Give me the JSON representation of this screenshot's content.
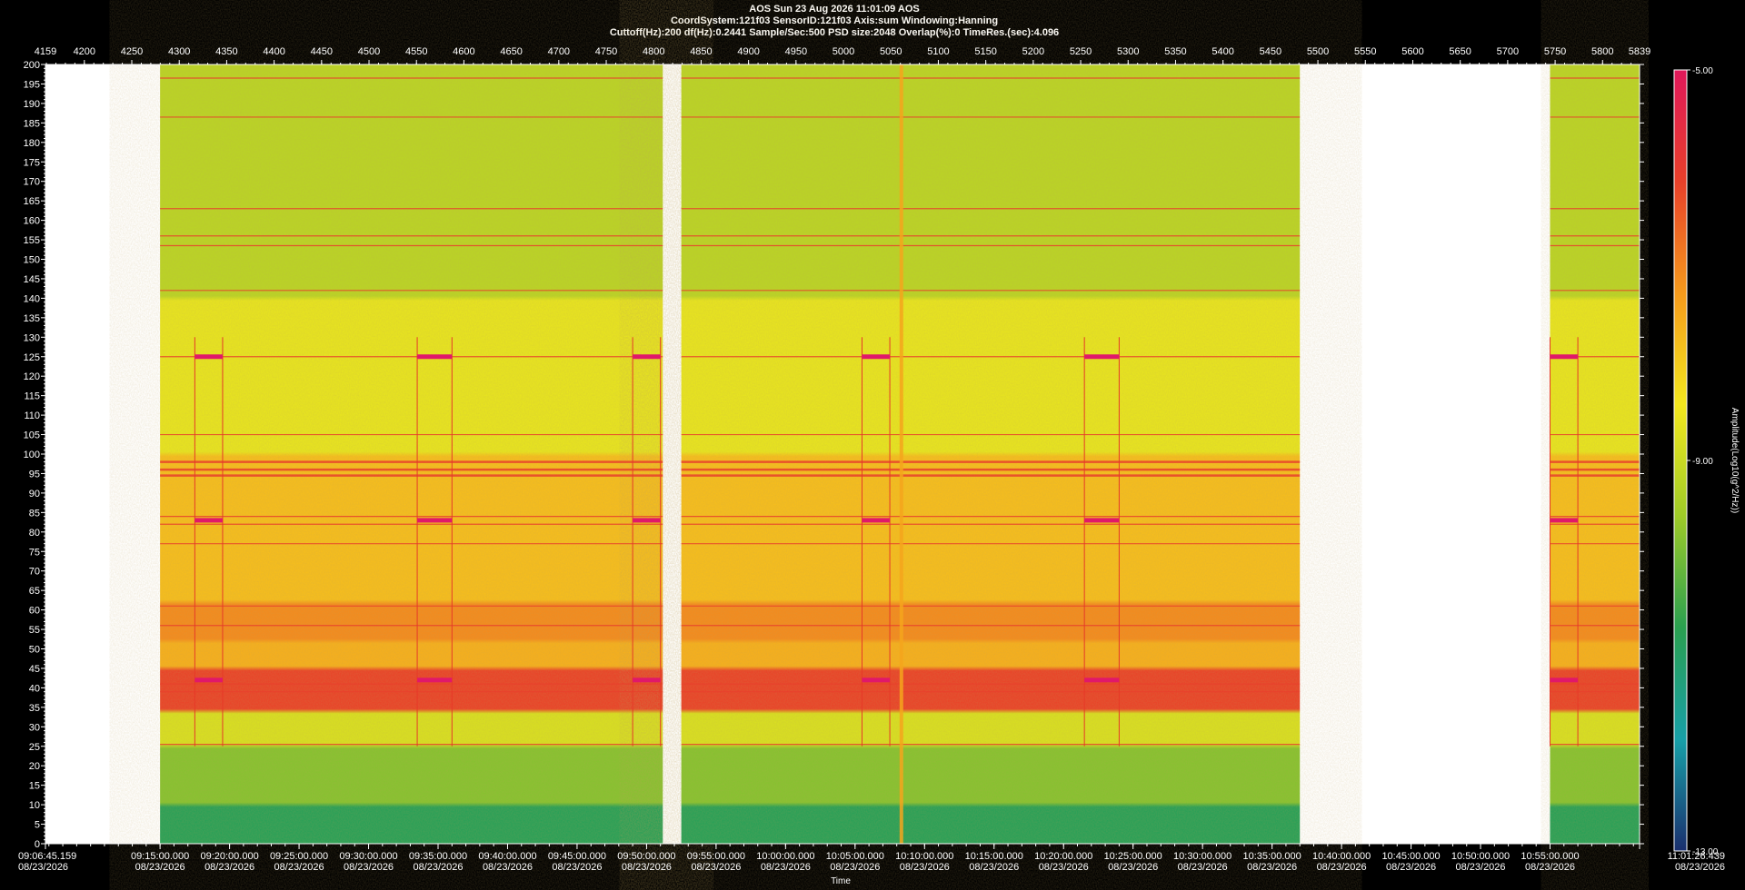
{
  "header": {
    "line1": "AOS  Sun 23 Aug 2026 11:01:09  AOS",
    "line2": "CoordSystem:121f03   SensorID:121f03   Axis:sum    Windowing:Hanning",
    "line3": "Cuttoff(Hz):200     df(Hz):0.2441     Sample/Sec:500     PSD size:2048      Overlap(%):0       TimeRes.(sec):4.096"
  },
  "chart_data": {
    "type": "heatmap",
    "title": "AOS  Sun 23 Aug 2026 11:01:09  AOS",
    "xlabel": "Time",
    "ylabel": "",
    "colorbar_label": "Amplitude(Log10(g^2/Hz))",
    "ylim": [
      0,
      200
    ],
    "y_ticks": [
      0,
      5,
      10,
      15,
      20,
      25,
      30,
      35,
      40,
      45,
      50,
      55,
      60,
      65,
      70,
      75,
      80,
      85,
      90,
      95,
      100,
      105,
      110,
      115,
      120,
      125,
      130,
      135,
      140,
      145,
      150,
      155,
      160,
      165,
      170,
      175,
      180,
      185,
      190,
      195,
      200
    ],
    "y_tick_labels": [
      "0",
      "5",
      "10",
      "15",
      "20",
      "25",
      "30",
      "35",
      "40",
      "45",
      "50",
      "55",
      "60",
      "65",
      "70",
      "75",
      "80",
      "85",
      "90",
      "95",
      "100",
      "105",
      "110",
      "115",
      "120",
      "125",
      "130",
      "135",
      "140",
      "145",
      "150",
      "155",
      "160",
      "165",
      "170",
      "175",
      "180",
      "185",
      "190",
      "195",
      "200"
    ],
    "top_axis_range": [
      4159,
      5839
    ],
    "top_ticks": [
      4200,
      4250,
      4300,
      4350,
      4400,
      4450,
      4500,
      4550,
      4600,
      4650,
      4700,
      4750,
      4800,
      4850,
      4900,
      4950,
      5000,
      5050,
      5100,
      5150,
      5200,
      5250,
      5300,
      5350,
      5400,
      5450,
      5500,
      5550,
      5600,
      5650,
      5700,
      5750,
      5800
    ],
    "top_end_labels": [
      "4159",
      "5839"
    ],
    "time_range": [
      "09:06:45.159",
      "11:01:26.439"
    ],
    "bottom_labels": [
      {
        "time": "09:06:45.159",
        "date": "08/23/2026"
      },
      {
        "time": "09:15:00.000",
        "date": "08/23/2026"
      },
      {
        "time": "09:20:00.000",
        "date": "08/23/2026"
      },
      {
        "time": "09:25:00.000",
        "date": "08/23/2026"
      },
      {
        "time": "09:30:00.000",
        "date": "08/23/2026"
      },
      {
        "time": "09:35:00.000",
        "date": "08/23/2026"
      },
      {
        "time": "09:40:00.000",
        "date": "08/23/2026"
      },
      {
        "time": "09:45:00.000",
        "date": "08/23/2026"
      },
      {
        "time": "09:50:00.000",
        "date": "08/23/2026"
      },
      {
        "time": "09:55:00.000",
        "date": "08/23/2026"
      },
      {
        "time": "10:00:00.000",
        "date": "08/23/2026"
      },
      {
        "time": "10:05:00.000",
        "date": "08/23/2026"
      },
      {
        "time": "10:10:00.000",
        "date": "08/23/2026"
      },
      {
        "time": "10:15:00.000",
        "date": "08/23/2026"
      },
      {
        "time": "10:20:00.000",
        "date": "08/23/2026"
      },
      {
        "time": "10:25:00.000",
        "date": "08/23/2026"
      },
      {
        "time": "10:30:00.000",
        "date": "08/23/2026"
      },
      {
        "time": "10:35:00.000",
        "date": "08/23/2026"
      },
      {
        "time": "10:40:00.000",
        "date": "08/23/2026"
      },
      {
        "time": "10:45:00.000",
        "date": "08/23/2026"
      },
      {
        "time": "10:50:00.000",
        "date": "08/23/2026"
      },
      {
        "time": "10:55:00.000",
        "date": "08/23/2026"
      },
      {
        "time": "11:01:26.439",
        "date": "08/23/2026"
      }
    ],
    "data_segments": [
      {
        "start": "09:15:00",
        "end": "09:51:10"
      },
      {
        "start": "09:52:30",
        "end": "10:37:00"
      },
      {
        "start": "10:55:00",
        "end": "11:01:26"
      }
    ],
    "colorbar": {
      "min": -13.0,
      "max": -5.0,
      "labels": [
        "-5.00",
        "-9.00",
        "-13.00"
      ],
      "colors": [
        "#1a2f6e",
        "#18a0a8",
        "#2aa050",
        "#9ecb28",
        "#f4e81e",
        "#f59a1c",
        "#e8402a",
        "#e0185a"
      ]
    },
    "spectral_bands": [
      {
        "freq_range": [
          0,
          10
        ],
        "level": -10.8
      },
      {
        "freq_range": [
          10,
          25
        ],
        "level": -9.8
      },
      {
        "freq_range": [
          25,
          34
        ],
        "level": -8.8
      },
      {
        "freq_range": [
          34,
          45
        ],
        "level": -6.2
      },
      {
        "freq_range": [
          45,
          52
        ],
        "level": -7.6
      },
      {
        "freq_range": [
          52,
          62
        ],
        "level": -7.1
      },
      {
        "freq_range": [
          62,
          100
        ],
        "level": -7.8
      },
      {
        "freq_range": [
          100,
          140
        ],
        "level": -8.6
      },
      {
        "freq_range": [
          140,
          200
        ],
        "level": -9.2
      }
    ],
    "tonal_lines_hz": [
      25.5,
      39,
      41,
      56,
      61,
      77,
      82,
      84,
      94.5,
      96,
      98,
      105,
      125,
      142,
      153.5,
      156,
      163,
      186.5,
      196.5
    ],
    "events": [
      {
        "start": "09:17:30",
        "end": "09:19:30"
      },
      {
        "start": "09:33:30",
        "end": "09:36:00"
      },
      {
        "start": "09:49:00",
        "end": "09:51:00"
      },
      {
        "start": "10:05:30",
        "end": "10:07:30"
      },
      {
        "start": "10:21:30",
        "end": "10:24:00"
      },
      {
        "start": "10:55:00",
        "end": "10:57:00"
      }
    ],
    "vertical_broadband_time": "10:08:20"
  }
}
